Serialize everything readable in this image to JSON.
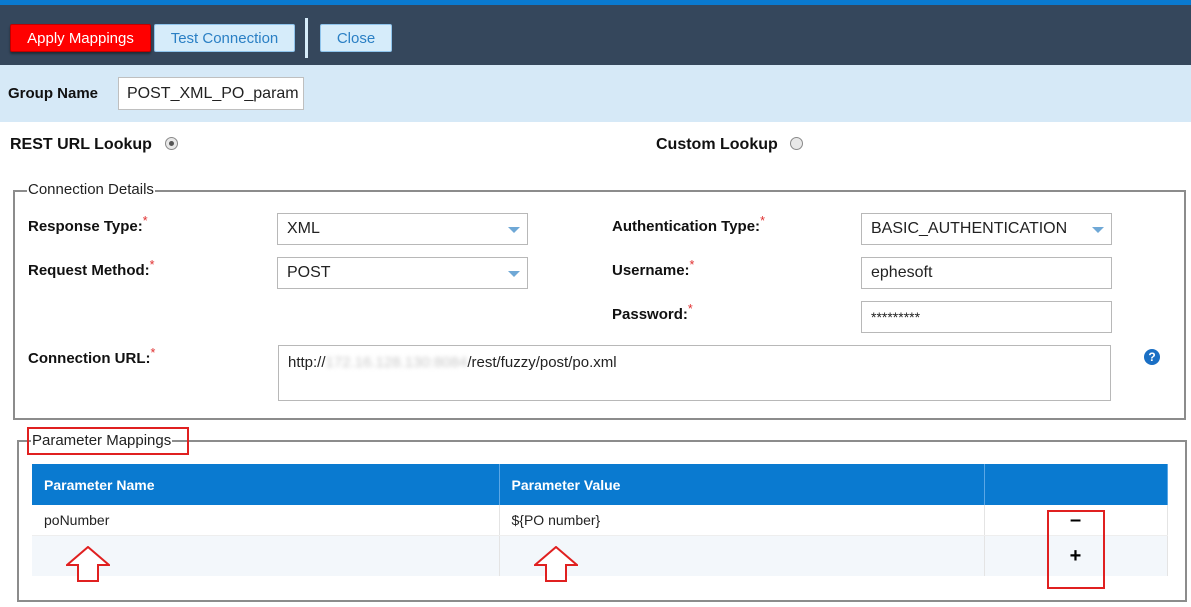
{
  "toolbar": {
    "apply_label": "Apply Mappings",
    "test_label": "Test Connection",
    "close_label": "Close"
  },
  "group": {
    "label": "Group Name",
    "value": "POST_XML_PO_param"
  },
  "lookup": {
    "rest_label": "REST URL Lookup",
    "rest_selected": true,
    "custom_label": "Custom Lookup",
    "custom_selected": false
  },
  "connection": {
    "legend": "Connection Details",
    "required_mark": "*",
    "response_type_label": "Response Type:",
    "response_type_value": "XML",
    "request_method_label": "Request Method:",
    "request_method_value": "POST",
    "auth_type_label": "Authentication Type:",
    "auth_type_value": "BASIC_AUTHENTICATION",
    "username_label": "Username:",
    "username_value": "ephesoft",
    "password_label": "Password:",
    "password_value": "*********",
    "url_label": "Connection URL:",
    "url_prefix": "http://",
    "url_host_blurred": "172.16.128.130:8084",
    "url_suffix": "/rest/fuzzy/post/po.xml",
    "help_icon": "question-circle-icon"
  },
  "parameters": {
    "legend": "Parameter Mappings",
    "columns": [
      "Parameter Name",
      "Parameter Value",
      ""
    ],
    "rows": [
      {
        "name": "poNumber",
        "value": "${PO number}"
      }
    ],
    "remove_icon": "minus-icon",
    "add_icon": "plus-icon"
  },
  "colors": {
    "header_bar": "#35475c",
    "accent": "#0a7ad0",
    "apply_button": "#ff0000",
    "annotation": "#e02020",
    "group_bar": "#d6e9f7"
  }
}
